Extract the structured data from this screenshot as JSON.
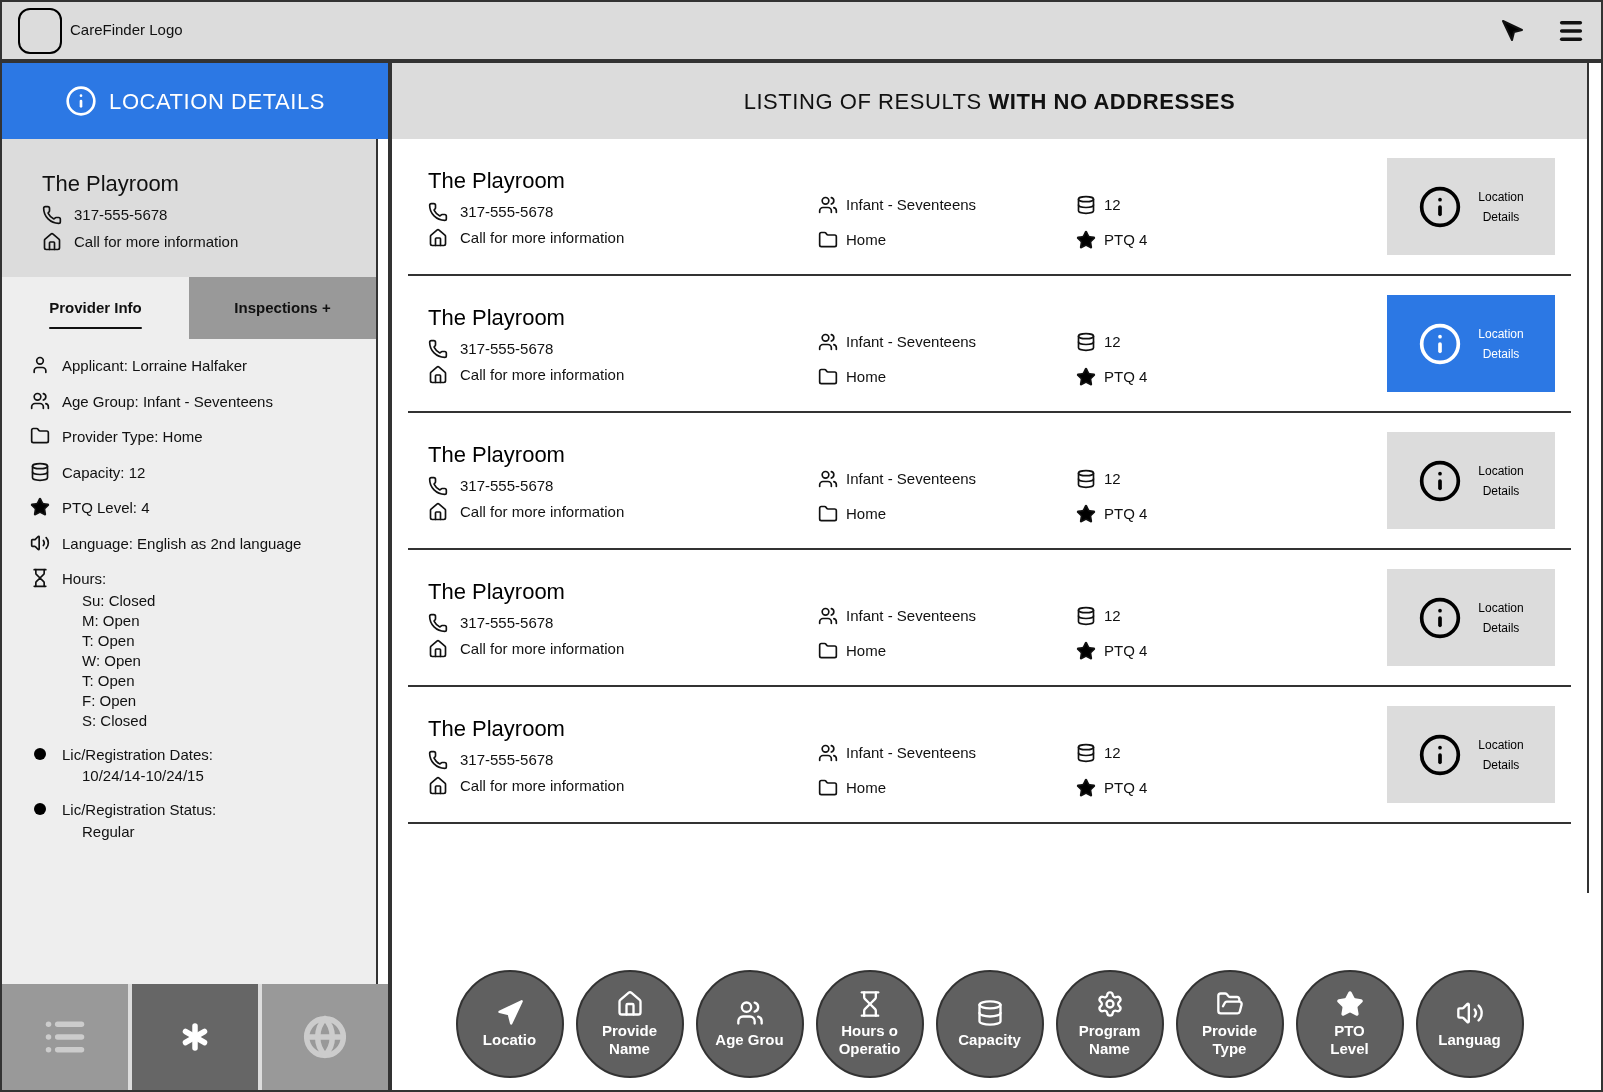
{
  "topbar": {
    "logo_text": "CareFinder Logo"
  },
  "sidebar": {
    "header": "LOCATION DETAILS",
    "provider": {
      "name": "The Playroom",
      "phone": "317-555-5678",
      "address": "Call for more information"
    },
    "tabs": [
      {
        "label": "Provider Info",
        "selected": true
      },
      {
        "label": "Inspections +",
        "selected": false
      }
    ],
    "details": [
      {
        "kind": "applicant",
        "text": "Applicant: Lorraine Halfaker"
      },
      {
        "kind": "age",
        "text": "Age Group:  Infant - Seventeens"
      },
      {
        "kind": "type",
        "text": "Provider Type: Home"
      },
      {
        "kind": "capacity",
        "text": "Capacity: 12"
      },
      {
        "kind": "ptq",
        "text": "PTQ Level: 4"
      },
      {
        "kind": "language",
        "text": "Language:  English as 2nd language"
      },
      {
        "kind": "hours",
        "text": "Hours:",
        "lines": [
          "Su:  Closed",
          "M: Open",
          "T: Open",
          "W: Open",
          "T: Open",
          "F: Open",
          "S: Closed"
        ]
      },
      {
        "kind": "bullet",
        "text": "Lic/Registration Dates:",
        "lines": [
          "10/24/14-10/24/15"
        ]
      },
      {
        "kind": "bullet",
        "text": "Lic/Registration Status:",
        "lines": [
          "Regular"
        ]
      }
    ],
    "bottom_tabs": [
      {
        "kind": "list",
        "selected": false
      },
      {
        "kind": "asterisk",
        "selected": true
      },
      {
        "kind": "globe",
        "selected": false
      }
    ]
  },
  "results": {
    "title": "LISTING OF RESULTS **WITH NO ADDRESSES**",
    "rows": [
      {
        "name": "The Playroom",
        "phone": "317-555-5678",
        "address": "Call for more information",
        "age_group": "Infant - Seventeens",
        "type": "Home",
        "capacity": "12",
        "ptq": "PTQ 4",
        "button": [
          "Location",
          "Details"
        ],
        "selected": false
      },
      {
        "name": "The Playroom",
        "phone": "317-555-5678",
        "address": "Call for more information",
        "age_group": "Infant - Seventeens",
        "type": "Home",
        "capacity": "12",
        "ptq": "PTQ 4",
        "button": [
          "Location",
          "Details"
        ],
        "selected": true
      },
      {
        "name": "The Playroom",
        "phone": "317-555-5678",
        "address": "Call for more information",
        "age_group": "Infant - Seventeens",
        "type": "Home",
        "capacity": "12",
        "ptq": "PTQ 4",
        "button": [
          "Location",
          "Details"
        ],
        "selected": false
      },
      {
        "name": "The Playroom",
        "phone": "317-555-5678",
        "address": "Call for more information",
        "age_group": "Infant - Seventeens",
        "type": "Home",
        "capacity": "12",
        "ptq": "PTQ 4",
        "button": [
          "Location",
          "Details"
        ],
        "selected": false
      },
      {
        "name": "The Playroom",
        "phone": "317-555-5678",
        "address": "Call for more information",
        "age_group": "Infant - Seventeens",
        "type": "Home",
        "capacity": "12",
        "ptq": "PTQ 4",
        "button": [
          "Location",
          "Details"
        ],
        "selected": false
      }
    ]
  },
  "filters": [
    {
      "kind": "location",
      "lines": [
        "Locatio"
      ]
    },
    {
      "kind": "provider_name",
      "lines": [
        "Provide",
        "Name"
      ]
    },
    {
      "kind": "age",
      "lines": [
        "Age Grou"
      ]
    },
    {
      "kind": "hours",
      "lines": [
        "Hours o",
        "Operatio"
      ]
    },
    {
      "kind": "capacity",
      "lines": [
        "Capacity"
      ]
    },
    {
      "kind": "program",
      "lines": [
        "Program",
        "Name"
      ]
    },
    {
      "kind": "type",
      "lines": [
        "Provide",
        "Type"
      ]
    },
    {
      "kind": "ptq",
      "lines": [
        "PTO",
        "Level"
      ]
    },
    {
      "kind": "language",
      "lines": [
        "Languag"
      ]
    }
  ]
}
